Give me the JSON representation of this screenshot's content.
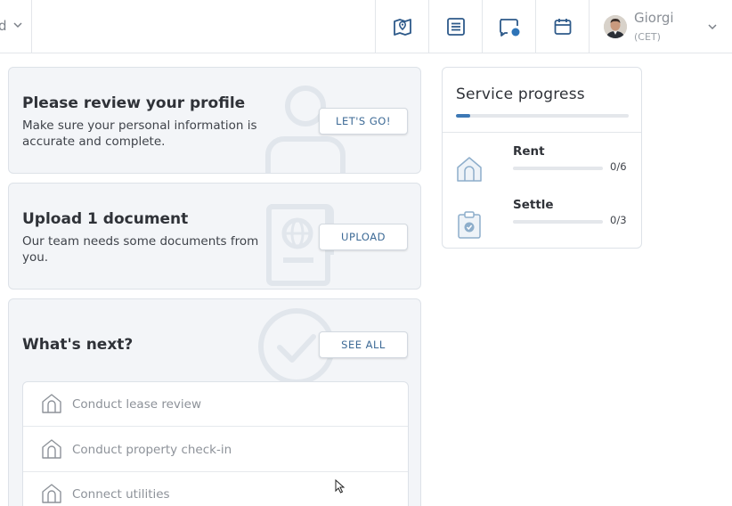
{
  "header": {
    "left_partial_text": "d",
    "icons": [
      "map-icon",
      "list-icon",
      "chat-icon",
      "calendar-icon"
    ],
    "user": {
      "name": "Giorgi",
      "timezone": "(CET)"
    }
  },
  "cards": {
    "profile": {
      "title": "Please review your profile",
      "description": "Make sure your personal information is accurate and complete.",
      "button": "LET'S GO!"
    },
    "upload": {
      "title": "Upload 1 document",
      "description": "Our team needs some documents from you.",
      "button": "UPLOAD"
    },
    "next": {
      "title": "What's next?",
      "button": "SEE ALL"
    }
  },
  "next_items": [
    {
      "label": "Conduct lease review",
      "icon": "house-icon"
    },
    {
      "label": "Conduct property check-in",
      "icon": "house-icon"
    },
    {
      "label": "Connect utilities",
      "icon": "house-icon"
    }
  ],
  "service_progress": {
    "title": "Service progress",
    "overall_fraction": 0.08,
    "rows": [
      {
        "name": "Rent",
        "count": "0/6",
        "fraction": 0,
        "icon": "house-icon"
      },
      {
        "name": "Settle",
        "count": "0/3",
        "fraction": 0,
        "icon": "clipboard-check-icon"
      }
    ]
  },
  "colors": {
    "accent": "#3d78b5",
    "card_bg": "#f3f5f8",
    "border": "#dde2e8"
  }
}
